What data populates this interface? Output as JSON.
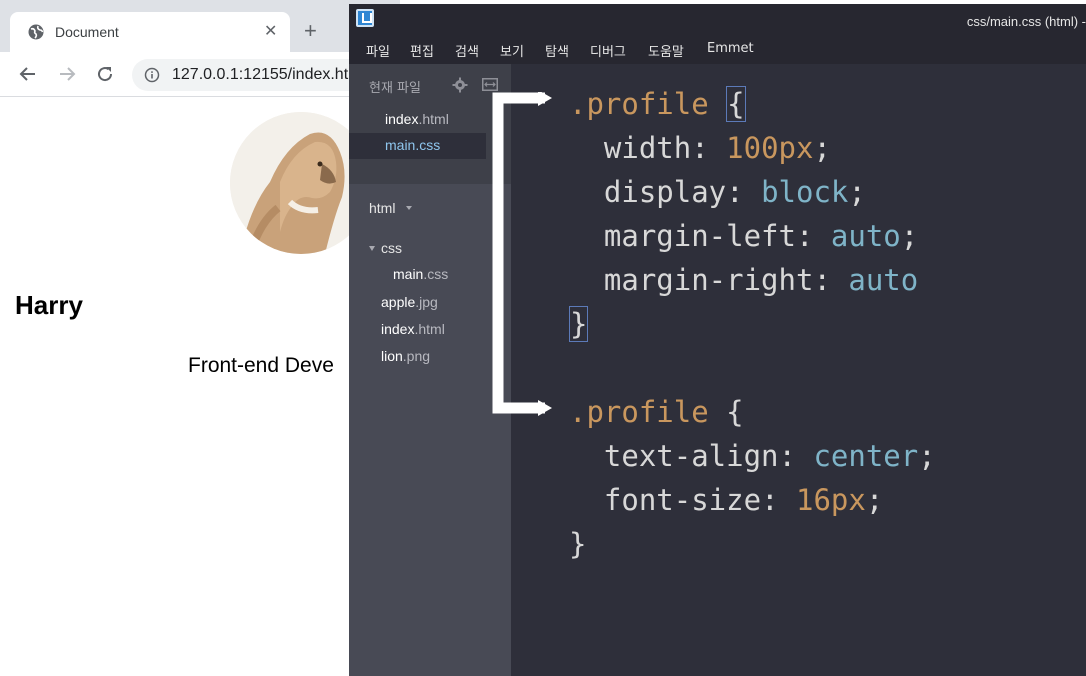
{
  "browser": {
    "tab_title": "Document",
    "url": "127.0.0.1:12155/index.ht",
    "profile": {
      "name": "Harry",
      "role": "Front-end Deve"
    }
  },
  "editor": {
    "window_title": "css/main.css (html) -",
    "menu": [
      "파일",
      "편집",
      "검색",
      "보기",
      "탐색",
      "디버그",
      "도움말",
      "Emmet"
    ],
    "sidebar": {
      "working_files_label": "현재 파일",
      "working_files": [
        {
          "name": "index",
          "ext": ".html",
          "active": false
        },
        {
          "name": "main",
          "ext": ".css",
          "active": true
        }
      ],
      "project_title": "html",
      "tree": {
        "folder": "css",
        "folder_children": [
          {
            "name": "main",
            "ext": ".css"
          }
        ],
        "files": [
          {
            "name": "apple",
            "ext": ".jpg"
          },
          {
            "name": "index",
            "ext": ".html"
          },
          {
            "name": "lion",
            "ext": ".png"
          }
        ]
      }
    },
    "code": {
      "block1": {
        "selector": ".profile",
        "open": "{",
        "decl": [
          {
            "prop": "width",
            "value": "100px",
            "end": ";",
            "value_type": "num"
          },
          {
            "prop": "display",
            "value": "block",
            "end": ";",
            "value_type": "kw"
          },
          {
            "prop": "margin-left",
            "value": "auto",
            "end": ";",
            "value_type": "kw"
          },
          {
            "prop": "margin-right",
            "value": "auto",
            "end": "",
            "value_type": "kw"
          }
        ],
        "close": "}"
      },
      "block2": {
        "selector": ".profile",
        "open": "{",
        "decl": [
          {
            "prop": "text-align",
            "value": "center",
            "end": ";",
            "value_type": "kw"
          },
          {
            "prop": "font-size",
            "value": "16px",
            "end": ";",
            "value_type": "num"
          }
        ],
        "close": "}"
      }
    },
    "colors": {
      "selector": "#c9975e",
      "keyword": "#7fb4c8",
      "background": "#2e2f3a",
      "sidebar": "#484a55"
    }
  }
}
